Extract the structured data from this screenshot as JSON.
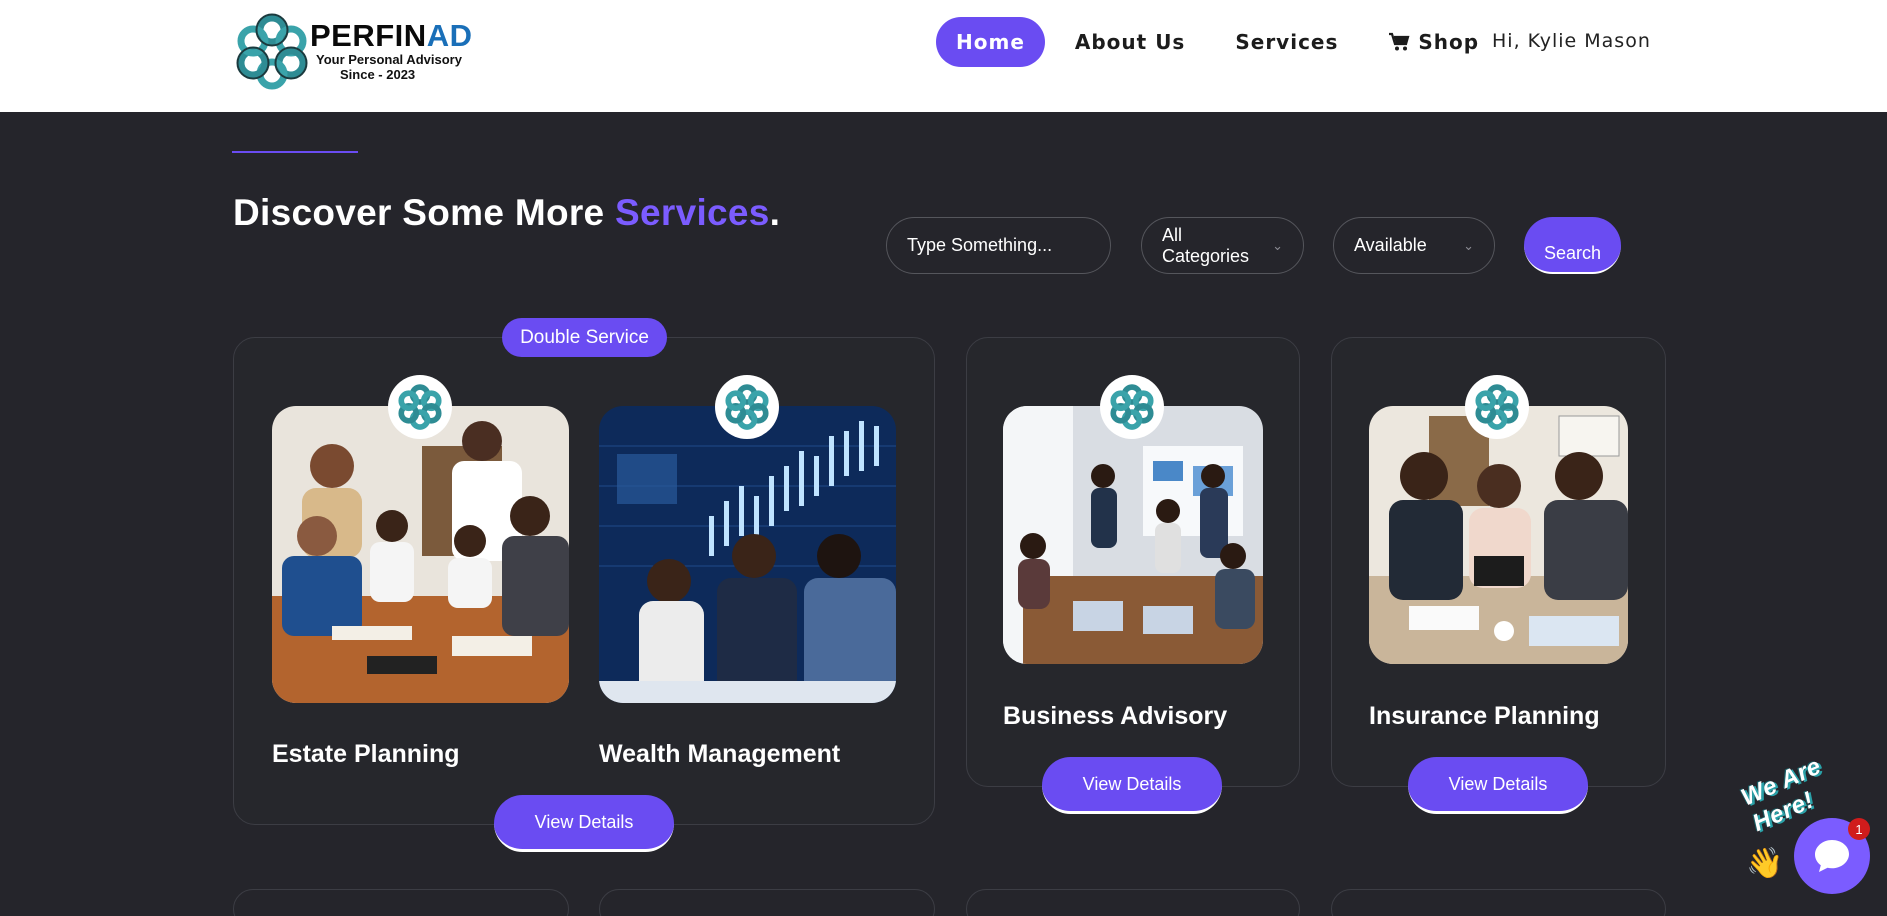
{
  "header": {
    "logo": {
      "title_part1": "PERFIN",
      "title_part2": "AD",
      "tagline": "Your Personal Advisory",
      "since": "Since - 2023"
    },
    "nav": [
      {
        "label": "Home",
        "active": true
      },
      {
        "label": "About Us",
        "active": false
      },
      {
        "label": "Services",
        "active": false
      },
      {
        "label": "Shop",
        "active": false,
        "icon": "cart-icon"
      }
    ],
    "greeting": "Hi, Kylie Mason"
  },
  "hero": {
    "title_part1": "Discover Some More ",
    "title_highlight": "Services",
    "title_end": "."
  },
  "filters": {
    "search_placeholder": "Type Something...",
    "category": "All Categories",
    "availability": "Available",
    "search_button": "Search"
  },
  "cards": {
    "double": {
      "badge": "Double Service",
      "services": [
        "Estate Planning",
        "Wealth Management"
      ],
      "button": "View Details"
    },
    "single": [
      {
        "name": "Business Advisory",
        "button": "View Details"
      },
      {
        "name": "Insurance Planning",
        "button": "View Details"
      }
    ]
  },
  "chat": {
    "label": "We Are Here!",
    "unread": "1"
  },
  "colors": {
    "accent": "#6a4cf2",
    "highlight": "#7b5cff",
    "background": "#25252b",
    "header": "#ffffff"
  }
}
